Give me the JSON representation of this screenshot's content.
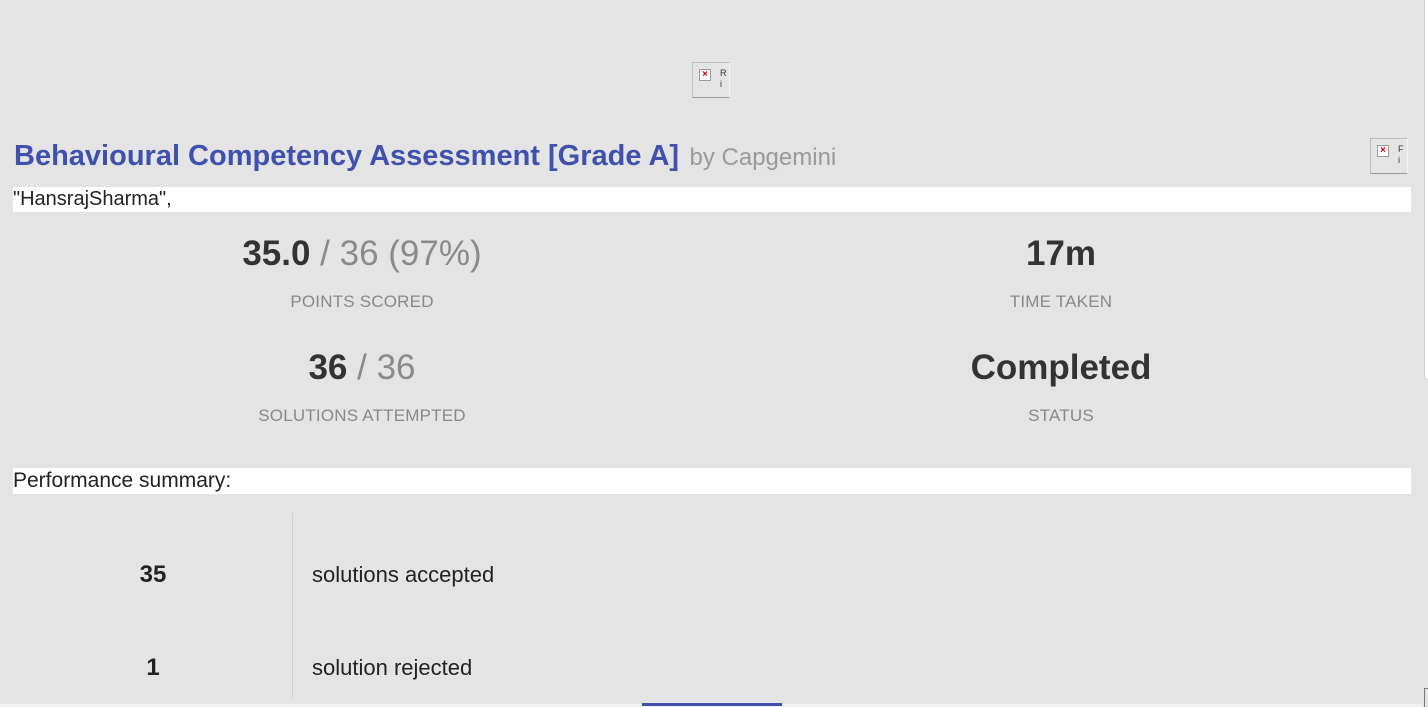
{
  "logo": {
    "alt_text": "R i"
  },
  "side_image": {
    "alt_text": "F i"
  },
  "header": {
    "title": "Behavioural Competency Assessment [Grade A]",
    "byline": "by Capgemini"
  },
  "candidate_name": "\"HansrajSharma\",",
  "stats": {
    "points": {
      "value": "35.0",
      "total": " / 36 (97%)",
      "label": "POINTS SCORED"
    },
    "time": {
      "value": "17m",
      "label": "TIME TAKEN"
    },
    "solutions": {
      "value": "36",
      "total": " / 36",
      "label": "SOLUTIONS ATTEMPTED"
    },
    "status": {
      "value": "Completed",
      "label": "STATUS"
    }
  },
  "performance": {
    "heading": "Performance summary:",
    "rows": [
      {
        "count": "35",
        "text": "solutions accepted"
      },
      {
        "count": "1",
        "text": "solution rejected"
      }
    ]
  }
}
